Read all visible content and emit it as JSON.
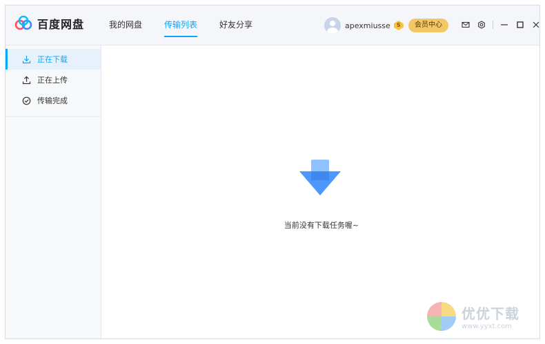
{
  "app": {
    "name": "百度网盘"
  },
  "nav": {
    "tabs": [
      "我的网盘",
      "传输列表",
      "好友分享"
    ],
    "active_index": 1
  },
  "user": {
    "name": "apexmiusse",
    "badge": "S"
  },
  "vip_button": "会员中心",
  "sidebar": {
    "items": [
      {
        "label": "正在下载",
        "icon": "download-icon",
        "active": true
      },
      {
        "label": "正在上传",
        "icon": "upload-icon",
        "active": false
      },
      {
        "label": "传输完成",
        "icon": "check-circle-icon",
        "active": false
      }
    ]
  },
  "main": {
    "empty_message": "当前没有下载任务喔~"
  },
  "watermark": {
    "title": "优优下载",
    "url": "www.yyxt.com"
  },
  "colors": {
    "accent": "#06a7ff",
    "vip": "#f3c766",
    "sidebar_bg": "#f7f8fa"
  }
}
